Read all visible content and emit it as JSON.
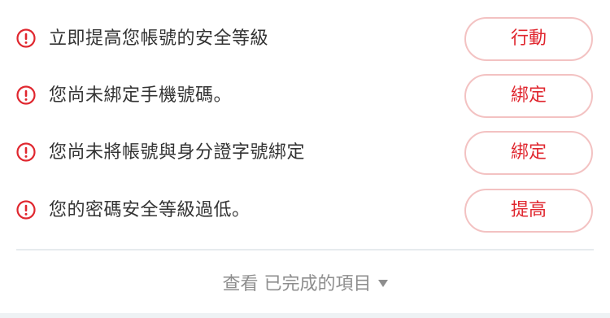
{
  "colors": {
    "alert": "#e0272f",
    "button_border": "#f3c2c2",
    "text": "#333333",
    "muted": "#8e8e8e"
  },
  "tasks": [
    {
      "icon": "alert-circle-icon",
      "label": "立即提高您帳號的安全等級",
      "action": "行動"
    },
    {
      "icon": "alert-circle-icon",
      "label": "您尚未綁定手機號碼。",
      "action": "綁定"
    },
    {
      "icon": "alert-circle-icon",
      "label": "您尚未將帳號與身分證字號綁定",
      "action": "綁定"
    },
    {
      "icon": "alert-circle-icon",
      "label": "您的密碼安全等級過低。",
      "action": "提高"
    }
  ],
  "footer": {
    "view_completed_label": "查看 已完成的項目"
  }
}
